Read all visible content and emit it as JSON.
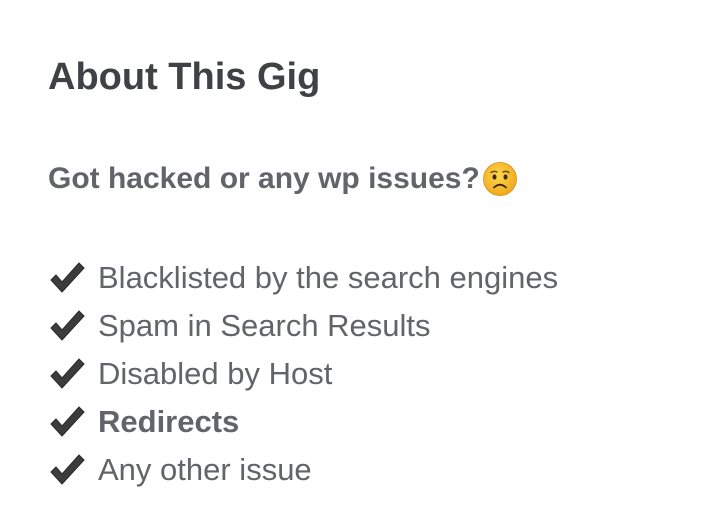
{
  "gig": {
    "section_title": "About This Gig",
    "subheading": "Got hacked or any wp issues?",
    "subheading_emoji": "worried-face-icon",
    "issues": [
      {
        "label": "Blacklisted by the search engines",
        "bold": false
      },
      {
        "label": "Spam in Search Results",
        "bold": false
      },
      {
        "label": "Disabled by Host",
        "bold": false
      },
      {
        "label": "Redirects",
        "bold": true
      },
      {
        "label": "Any other issue",
        "bold": false
      }
    ],
    "bullet_icon": "heavy-check-mark-icon"
  },
  "colors": {
    "title": "#404145",
    "body_text": "#62646a",
    "check_mark": "#3c3c3c",
    "emoji_face": "#f7c23b"
  }
}
